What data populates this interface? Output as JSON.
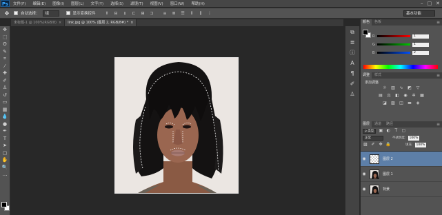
{
  "menubar": {
    "app_logo": "Ps",
    "items": [
      "文件(F)",
      "编辑(E)",
      "图像(I)",
      "图层(L)",
      "文字(Y)",
      "选择(S)",
      "滤镜(T)",
      "视图(V)",
      "窗口(W)",
      "帮助(H)"
    ]
  },
  "options_bar": {
    "auto_select_label": "自动选择：",
    "auto_select_value": "组",
    "transform_controls_label": "显示变换控件",
    "workspace": "基本功能"
  },
  "tabs": [
    {
      "label": "未标题-1 @ 100%(RGB/8)",
      "close": "×"
    },
    {
      "label": "link.jpg @ 100% (图层 2, RGB/8#) *",
      "close": "×"
    }
  ],
  "panels": {
    "color": {
      "tabs": [
        "颜色",
        "色板"
      ],
      "channels": [
        {
          "label": "R",
          "value": "1"
        },
        {
          "label": "G",
          "value": "1"
        },
        {
          "label": "B",
          "value": "2"
        }
      ]
    },
    "adjustments": {
      "tabs": [
        "调整",
        "样式"
      ],
      "heading": "添加调整"
    },
    "layers": {
      "tabs": [
        "图层",
        "通道",
        "路径"
      ],
      "filter": "ρ 类型",
      "blend_mode": "正常",
      "opacity_label": "不透明度:",
      "opacity": "100%",
      "fill_label": "填充:",
      "fill": "100%",
      "items": [
        {
          "name": "图层 2"
        },
        {
          "name": "图层 1"
        },
        {
          "name": "背景"
        }
      ]
    }
  }
}
